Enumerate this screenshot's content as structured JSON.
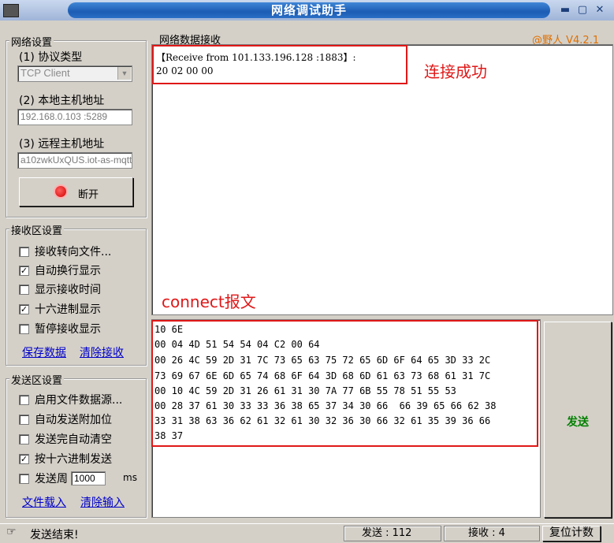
{
  "window": {
    "title": "网络调试助手",
    "version": "@野人 V4.2.1"
  },
  "network_settings": {
    "group_title": "网络设置",
    "protocol_label": "(1) 协议类型",
    "protocol_value": "TCP Client",
    "local_label": "(2) 本地主机地址",
    "local_value": "192.168.0.103 :5289",
    "remote_label": "(3) 远程主机地址",
    "remote_value": "a10zwkUxQUS.iot-as-mqtt",
    "disconnect_button": "断开"
  },
  "recv_settings": {
    "group_title": "接收区设置",
    "options": [
      {
        "label": "接收转向文件...",
        "checked": false
      },
      {
        "label": "自动换行显示",
        "checked": true
      },
      {
        "label": "显示接收时间",
        "checked": false
      },
      {
        "label": "十六进制显示",
        "checked": true
      },
      {
        "label": "暂停接收显示",
        "checked": false
      }
    ],
    "save_link": "保存数据",
    "clear_link": "清除接收"
  },
  "send_settings": {
    "group_title": "发送区设置",
    "options": [
      {
        "label": "启用文件数据源...",
        "checked": false
      },
      {
        "label": "自动发送附加位",
        "checked": false
      },
      {
        "label": "发送完自动清空",
        "checked": false
      },
      {
        "label": "按十六进制发送",
        "checked": true
      }
    ],
    "period_label": "发送周",
    "period_value": "1000",
    "period_unit": "ms",
    "load_link": "文件载入",
    "clear_link": "清除输入"
  },
  "receive_area": {
    "title": "网络数据接收",
    "lines": [
      "【Receive from 101.133.196.128 :1883】:",
      "20 02 00 00"
    ]
  },
  "send_area": {
    "lines": [
      "10 6E",
      "00 04 4D 51 54 54 04 C2 00 64",
      "00 26 4C 59 2D 31 7C 73 65 63 75 72 65 6D 6F 64 65 3D 33 2C",
      "73 69 67 6E 6D 65 74 68 6F 64 3D 68 6D 61 63 73 68 61 31 7C",
      "00 10 4C 59 2D 31 26 61 31 30 7A 77 6B 55 78 51 55 53",
      "00 28 37 61 30 33 33 36 38 65 37 34 30 66  66 39 65 66 62 38",
      "33 31 38 63 36 62 61 32 61 30 32 36 30 66 32 61 35 39 36 66",
      "38 37"
    ],
    "send_button": "发送"
  },
  "annotations": {
    "connect_success": "连接成功",
    "connect_packet": "connect报文"
  },
  "status_bar": {
    "message": "发送结束!",
    "sent_label": "发送 : 112",
    "recv_label": "接收 : 4",
    "reset_button": "复位计数"
  },
  "colors": {
    "accent": "#e01818",
    "send_button_text": "#008000",
    "version_text": "#e07000",
    "link": "#0000c8"
  }
}
